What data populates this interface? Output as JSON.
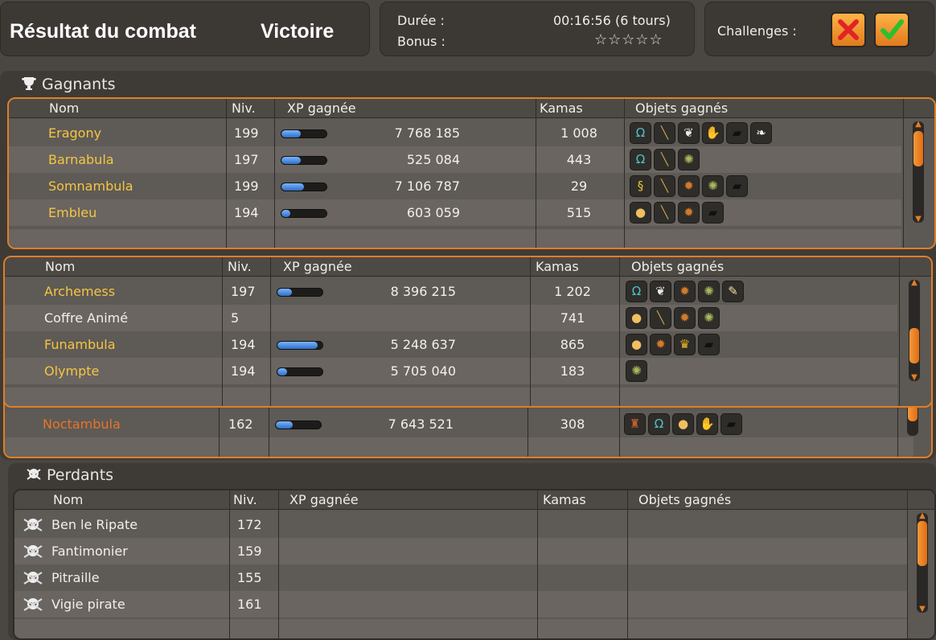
{
  "header": {
    "title": "Résultat du combat",
    "result": "Victoire",
    "duration_label": "Durée :",
    "duration_value": "00:16:56 (6 tours)",
    "bonus_label": "Bonus :",
    "bonus_stars": "☆☆☆☆☆",
    "challenges_label": "Challenges :",
    "challenges": [
      {
        "status": "failed",
        "icon": "red-cross-icon",
        "color": "#e02424"
      },
      {
        "status": "success",
        "icon": "green-check-icon",
        "color": "#2dbf2d"
      }
    ]
  },
  "columns": {
    "name": "Nom",
    "level": "Niv.",
    "xp": "XP gagnée",
    "kamas": "Kamas",
    "items": "Objets gagnés"
  },
  "winners": {
    "title": "Gagnants",
    "team1": [
      {
        "name": "Eragony",
        "level": "199",
        "xp": "7 768 185",
        "xp_fill": 0.42,
        "kamas": "1 008",
        "items": [
          "cape-icon",
          "staff-icon",
          "feather-icon",
          "wing-icon",
          "stone-icon",
          "tooth-icon"
        ]
      },
      {
        "name": "Barnabula",
        "level": "197",
        "xp": "525 084",
        "xp_fill": 0.42,
        "kamas": "443",
        "items": [
          "cape-icon",
          "staff-icon",
          "shell-icon"
        ]
      },
      {
        "name": "Somnambula",
        "level": "199",
        "xp": "7 106 787",
        "xp_fill": 0.5,
        "kamas": "29",
        "items": [
          "vine-icon",
          "staff-icon",
          "fur-icon",
          "shell-icon",
          "stone-icon"
        ]
      },
      {
        "name": "Embleu",
        "level": "194",
        "xp": "603 059",
        "xp_fill": 0.2,
        "kamas": "515",
        "items": [
          "egg-icon",
          "staff-icon",
          "fur-icon",
          "stone-icon"
        ]
      }
    ],
    "team2": [
      {
        "name": "Archemess",
        "level": "197",
        "xp": "8 396 215",
        "xp_fill": 0.32,
        "kamas": "1 202",
        "name_style": "yellow",
        "items": [
          "cape-icon",
          "feather-icon",
          "fur-icon",
          "shell-icon",
          "bone-icon"
        ]
      },
      {
        "name": "Coffre Animé",
        "level": "5",
        "xp": "",
        "xp_fill": null,
        "kamas": "741",
        "name_style": "white",
        "items": [
          "egg-icon",
          "staff-icon",
          "fur-icon",
          "shell-icon"
        ]
      },
      {
        "name": "Funambula",
        "level": "194",
        "xp": "5 248 637",
        "xp_fill": 0.9,
        "kamas": "865",
        "name_style": "yellow",
        "items": [
          "egg-icon",
          "fur-icon",
          "crown-icon",
          "stone-icon"
        ]
      },
      {
        "name": "Olympte",
        "level": "194",
        "xp": "5 705 040",
        "xp_fill": 0.22,
        "kamas": "183",
        "name_style": "yellow",
        "items": [
          "shell-icon"
        ]
      }
    ],
    "team3": [
      {
        "name": "Noctambula",
        "level": "162",
        "xp": "7 643 521",
        "xp_fill": 0.38,
        "kamas": "308",
        "items": [
          "potion-icon",
          "cape-icon",
          "egg-icon",
          "wing-icon",
          "stone-icon"
        ]
      }
    ]
  },
  "losers": {
    "title": "Perdants",
    "rows": [
      {
        "name": "Ben le Ripate",
        "level": "172"
      },
      {
        "name": "Fantimonier",
        "level": "159"
      },
      {
        "name": "Pitraille",
        "level": "155"
      },
      {
        "name": "Vigie pirate",
        "level": "161"
      }
    ]
  },
  "colors": {
    "accent_orange": "#e07e26",
    "winner_name": "#f5c542",
    "noctambula_name": "#e8742a"
  }
}
